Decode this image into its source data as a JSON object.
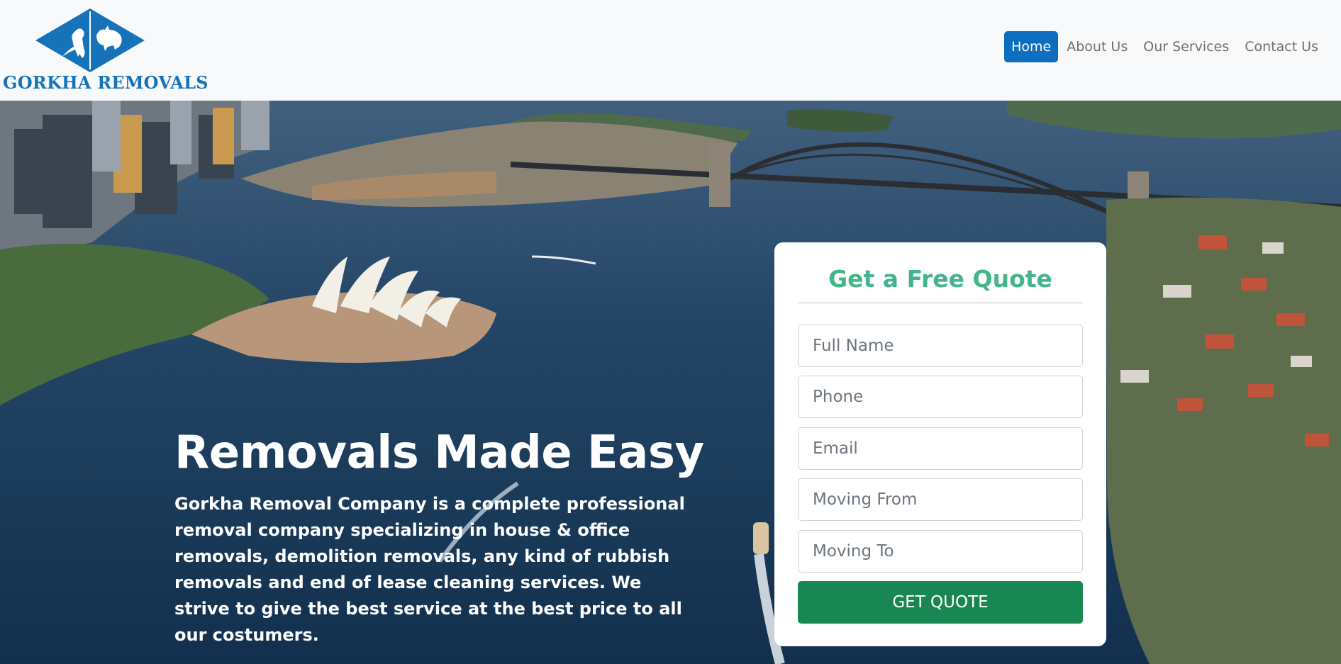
{
  "brand": {
    "name": "GORKHA REMOVALS",
    "color": "#1673b9"
  },
  "nav": {
    "items": [
      {
        "label": "Home",
        "active": true
      },
      {
        "label": "About Us",
        "active": false
      },
      {
        "label": "Our Services",
        "active": false
      },
      {
        "label": "Contact Us",
        "active": false
      }
    ]
  },
  "hero": {
    "title": "Removals Made Easy",
    "description": "Gorkha Removal Company is a complete professional removal company specializing in house & office removals, demolition removals, any kind of rubbish removals and end of lease cleaning services. We strive to give the best service at the best price to all our costumers.",
    "background": "aerial-photo-sydney-harbour-bridge-opera-house"
  },
  "quote_form": {
    "title": "Get a Free Quote",
    "fields": [
      {
        "placeholder": "Full Name",
        "value": ""
      },
      {
        "placeholder": "Phone",
        "value": ""
      },
      {
        "placeholder": "Email",
        "value": ""
      },
      {
        "placeholder": "Moving From",
        "value": ""
      },
      {
        "placeholder": "Moving To",
        "value": ""
      }
    ],
    "submit_label": "GET QUOTE"
  },
  "colors": {
    "nav_active": "#0d6ebf",
    "quote_title": "#44b48a",
    "button": "#198754"
  }
}
